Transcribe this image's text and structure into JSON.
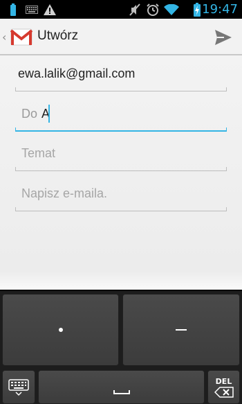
{
  "status_bar": {
    "time": "19:47",
    "accent_color": "#33b5e5",
    "icons": [
      "battery-small-icon",
      "keyboard-icon",
      "warning-icon",
      "mute-icon",
      "alarm-icon",
      "wifi-icon",
      "battery-charging-icon"
    ]
  },
  "action_bar": {
    "back_glyph": "‹",
    "title": "Utwórz",
    "app_icon": "gmail-icon",
    "send_icon": "send-icon"
  },
  "compose": {
    "from": "ewa.lalik@gmail.com",
    "to_label": "Do",
    "to_value": "A",
    "subject_placeholder": "Temat",
    "body_placeholder": "Napisz e-maila."
  },
  "keyboard": {
    "keys": [
      "dot-key",
      "dash-key",
      "keyboard-switch-key",
      "space-key",
      "delete-key"
    ],
    "del_label": "DEL"
  }
}
